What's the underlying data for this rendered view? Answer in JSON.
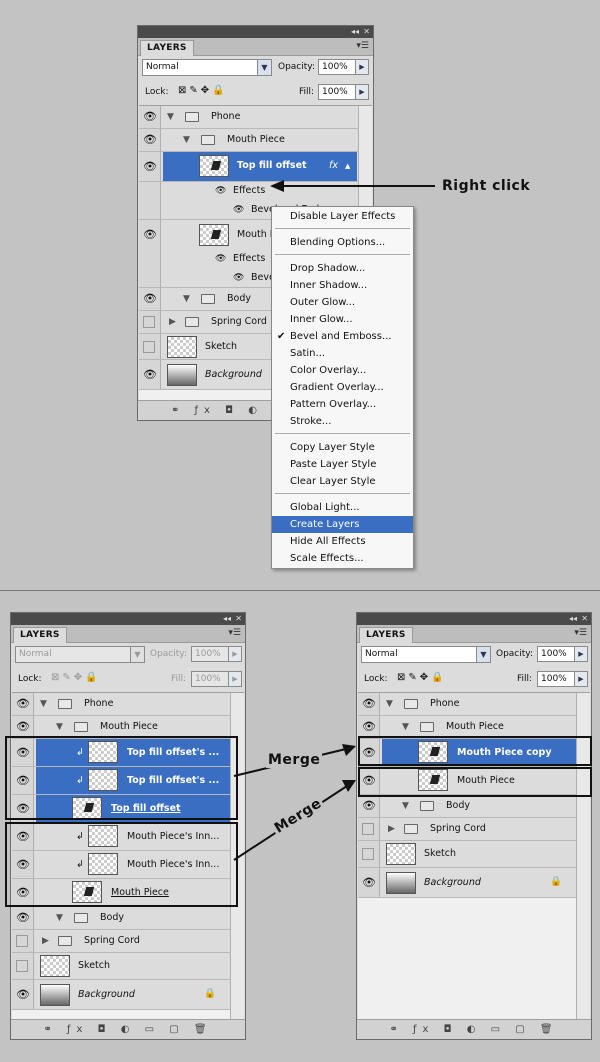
{
  "panel_title": "LAYERS",
  "menu_icon": "panel-menu-icon",
  "blend_mode": "Normal",
  "opacity_label": "Opacity:",
  "opacity_value": "100%",
  "lock_label": "Lock:",
  "fill_label": "Fill:",
  "fill_value": "100%",
  "layers_top": {
    "phone": "Phone",
    "mouth_piece": "Mouth Piece",
    "top_fill_offset": "Top fill offset",
    "effects": "Effects",
    "bevel_emboss_1": "Bevel and Emboss",
    "mouth": "Mouth Piece",
    "effects2": "Effects",
    "bevel_emboss_2": "Bevel and Emboss",
    "body": "Body",
    "spring_cord": "Spring Cord",
    "sketch": "Sketch",
    "background": "Background",
    "fx": "fx"
  },
  "context_menu": [
    {
      "label": "Disable Layer Effects"
    },
    {
      "label": "Blending Options..."
    },
    {
      "label": "Drop Shadow..."
    },
    {
      "label": "Inner Shadow..."
    },
    {
      "label": "Outer Glow..."
    },
    {
      "label": "Inner Glow..."
    },
    {
      "label": "Bevel and Emboss...",
      "checked": true
    },
    {
      "label": "Satin..."
    },
    {
      "label": "Color Overlay..."
    },
    {
      "label": "Gradient Overlay..."
    },
    {
      "label": "Pattern Overlay..."
    },
    {
      "label": "Stroke..."
    },
    {
      "label": "Copy Layer Style"
    },
    {
      "label": "Paste Layer Style"
    },
    {
      "label": "Clear Layer Style"
    },
    {
      "label": "Global Light..."
    },
    {
      "label": "Create Layers",
      "highlighted": true
    },
    {
      "label": "Hide All Effects"
    },
    {
      "label": "Scale Effects..."
    }
  ],
  "callout_right_click": "Right click",
  "callout_merge": "Merge",
  "layers_left": {
    "phone": "Phone",
    "mouth_piece": "Mouth Piece",
    "tfo_a": "Top fill offset's ...",
    "tfo_b": "Top fill offset's ...",
    "tfo": "Top fill offset",
    "mpi_a": "Mouth Piece's Inn...",
    "mpi_b": "Mouth Piece's Inn...",
    "mp": "Mouth Piece",
    "body": "Body",
    "spring_cord": "Spring Cord",
    "sketch": "Sketch",
    "background": "Background"
  },
  "layers_right": {
    "phone": "Phone",
    "mouth_piece": "Mouth Piece",
    "mp_copy": "Mouth Piece copy",
    "mp": "Mouth Piece",
    "body": "Body",
    "spring_cord": "Spring Cord",
    "sketch": "Sketch",
    "background": "Background"
  },
  "footer_icons": "link fx mask adjust folder new trash",
  "checkmark": "✔",
  "eye_glyph": "👁"
}
